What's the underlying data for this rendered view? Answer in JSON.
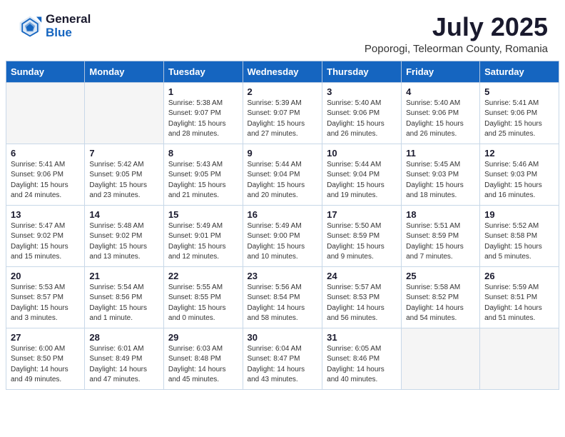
{
  "logo": {
    "general": "General",
    "blue": "Blue"
  },
  "header": {
    "month": "July 2025",
    "location": "Poporogi, Teleorman County, Romania"
  },
  "weekdays": [
    "Sunday",
    "Monday",
    "Tuesday",
    "Wednesday",
    "Thursday",
    "Friday",
    "Saturday"
  ],
  "weeks": [
    [
      {
        "day": "",
        "info": ""
      },
      {
        "day": "",
        "info": ""
      },
      {
        "day": "1",
        "info": "Sunrise: 5:38 AM\nSunset: 9:07 PM\nDaylight: 15 hours and 28 minutes."
      },
      {
        "day": "2",
        "info": "Sunrise: 5:39 AM\nSunset: 9:07 PM\nDaylight: 15 hours and 27 minutes."
      },
      {
        "day": "3",
        "info": "Sunrise: 5:40 AM\nSunset: 9:06 PM\nDaylight: 15 hours and 26 minutes."
      },
      {
        "day": "4",
        "info": "Sunrise: 5:40 AM\nSunset: 9:06 PM\nDaylight: 15 hours and 26 minutes."
      },
      {
        "day": "5",
        "info": "Sunrise: 5:41 AM\nSunset: 9:06 PM\nDaylight: 15 hours and 25 minutes."
      }
    ],
    [
      {
        "day": "6",
        "info": "Sunrise: 5:41 AM\nSunset: 9:06 PM\nDaylight: 15 hours and 24 minutes."
      },
      {
        "day": "7",
        "info": "Sunrise: 5:42 AM\nSunset: 9:05 PM\nDaylight: 15 hours and 23 minutes."
      },
      {
        "day": "8",
        "info": "Sunrise: 5:43 AM\nSunset: 9:05 PM\nDaylight: 15 hours and 21 minutes."
      },
      {
        "day": "9",
        "info": "Sunrise: 5:44 AM\nSunset: 9:04 PM\nDaylight: 15 hours and 20 minutes."
      },
      {
        "day": "10",
        "info": "Sunrise: 5:44 AM\nSunset: 9:04 PM\nDaylight: 15 hours and 19 minutes."
      },
      {
        "day": "11",
        "info": "Sunrise: 5:45 AM\nSunset: 9:03 PM\nDaylight: 15 hours and 18 minutes."
      },
      {
        "day": "12",
        "info": "Sunrise: 5:46 AM\nSunset: 9:03 PM\nDaylight: 15 hours and 16 minutes."
      }
    ],
    [
      {
        "day": "13",
        "info": "Sunrise: 5:47 AM\nSunset: 9:02 PM\nDaylight: 15 hours and 15 minutes."
      },
      {
        "day": "14",
        "info": "Sunrise: 5:48 AM\nSunset: 9:02 PM\nDaylight: 15 hours and 13 minutes."
      },
      {
        "day": "15",
        "info": "Sunrise: 5:49 AM\nSunset: 9:01 PM\nDaylight: 15 hours and 12 minutes."
      },
      {
        "day": "16",
        "info": "Sunrise: 5:49 AM\nSunset: 9:00 PM\nDaylight: 15 hours and 10 minutes."
      },
      {
        "day": "17",
        "info": "Sunrise: 5:50 AM\nSunset: 8:59 PM\nDaylight: 15 hours and 9 minutes."
      },
      {
        "day": "18",
        "info": "Sunrise: 5:51 AM\nSunset: 8:59 PM\nDaylight: 15 hours and 7 minutes."
      },
      {
        "day": "19",
        "info": "Sunrise: 5:52 AM\nSunset: 8:58 PM\nDaylight: 15 hours and 5 minutes."
      }
    ],
    [
      {
        "day": "20",
        "info": "Sunrise: 5:53 AM\nSunset: 8:57 PM\nDaylight: 15 hours and 3 minutes."
      },
      {
        "day": "21",
        "info": "Sunrise: 5:54 AM\nSunset: 8:56 PM\nDaylight: 15 hours and 1 minute."
      },
      {
        "day": "22",
        "info": "Sunrise: 5:55 AM\nSunset: 8:55 PM\nDaylight: 15 hours and 0 minutes."
      },
      {
        "day": "23",
        "info": "Sunrise: 5:56 AM\nSunset: 8:54 PM\nDaylight: 14 hours and 58 minutes."
      },
      {
        "day": "24",
        "info": "Sunrise: 5:57 AM\nSunset: 8:53 PM\nDaylight: 14 hours and 56 minutes."
      },
      {
        "day": "25",
        "info": "Sunrise: 5:58 AM\nSunset: 8:52 PM\nDaylight: 14 hours and 54 minutes."
      },
      {
        "day": "26",
        "info": "Sunrise: 5:59 AM\nSunset: 8:51 PM\nDaylight: 14 hours and 51 minutes."
      }
    ],
    [
      {
        "day": "27",
        "info": "Sunrise: 6:00 AM\nSunset: 8:50 PM\nDaylight: 14 hours and 49 minutes."
      },
      {
        "day": "28",
        "info": "Sunrise: 6:01 AM\nSunset: 8:49 PM\nDaylight: 14 hours and 47 minutes."
      },
      {
        "day": "29",
        "info": "Sunrise: 6:03 AM\nSunset: 8:48 PM\nDaylight: 14 hours and 45 minutes."
      },
      {
        "day": "30",
        "info": "Sunrise: 6:04 AM\nSunset: 8:47 PM\nDaylight: 14 hours and 43 minutes."
      },
      {
        "day": "31",
        "info": "Sunrise: 6:05 AM\nSunset: 8:46 PM\nDaylight: 14 hours and 40 minutes."
      },
      {
        "day": "",
        "info": ""
      },
      {
        "day": "",
        "info": ""
      }
    ]
  ]
}
